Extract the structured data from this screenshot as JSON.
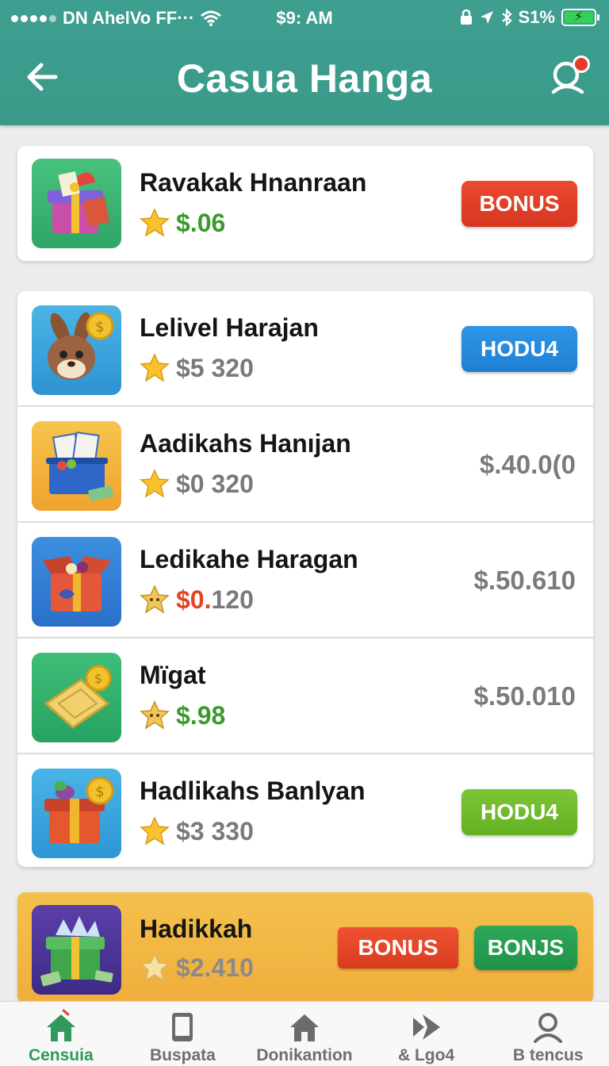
{
  "status_bar": {
    "carrier": "DN AhelVo FF···",
    "time": "$9: AM",
    "battery": "S1%",
    "battery_level": 0.85
  },
  "header": {
    "title": "Casua Hanga",
    "back_icon": "arrow-left-icon",
    "search_icon": "search-icon",
    "notification_dot_color": "#e63b2e"
  },
  "featured": {
    "name": "Ravakak Hnanraan",
    "amount": "$.06",
    "button": "BONUS",
    "icon": "gift-box-icon"
  },
  "list": [
    {
      "name": "Lelivel Harajan",
      "amount": "$5 320",
      "button": "HODU4",
      "button_style": "blue",
      "icon": "rabbit-coin-icon"
    },
    {
      "name": "Aadikahs Hanıjan",
      "amount": "$0 320",
      "price": "$.40.0(0",
      "icon": "basket-icon"
    },
    {
      "name": "Ledikahe Haragan",
      "amount_prefix": "$0.",
      "amount_suffix": "120",
      "price": "$.50.610",
      "icon": "open-box-icon"
    },
    {
      "name": "Mïgat",
      "amount": "$.98",
      "price": "$.50.010",
      "icon": "gold-ticket-icon"
    },
    {
      "name": "Hadlikahs Banlyan",
      "amount": "$3 330",
      "button": "HODU4",
      "button_style": "lime",
      "icon": "gift-coin-icon"
    }
  ],
  "promo": {
    "name": "Hadikkah",
    "amount": "$2.410",
    "button_1": "BONUS",
    "button_2": "BONJS",
    "icon": "green-gift-icon"
  },
  "tabs": [
    {
      "label": "Censuia",
      "icon": "home-icon",
      "active": true
    },
    {
      "label": "Buspata",
      "icon": "tablet-icon",
      "active": false
    },
    {
      "label": "Donikantion",
      "icon": "house-icon",
      "active": false
    },
    {
      "label": "& Lgo4",
      "icon": "forward-icon",
      "active": false
    },
    {
      "label": "B tencus",
      "icon": "profile-icon",
      "active": false
    }
  ],
  "colors": {
    "header": "#3a9a8a",
    "accent_green": "#3a9a2c",
    "bonus_red": "#d73620",
    "hodu_blue": "#1f7fd3",
    "hodu_lime": "#64b122",
    "promo_bg": "#f0ad3c"
  }
}
